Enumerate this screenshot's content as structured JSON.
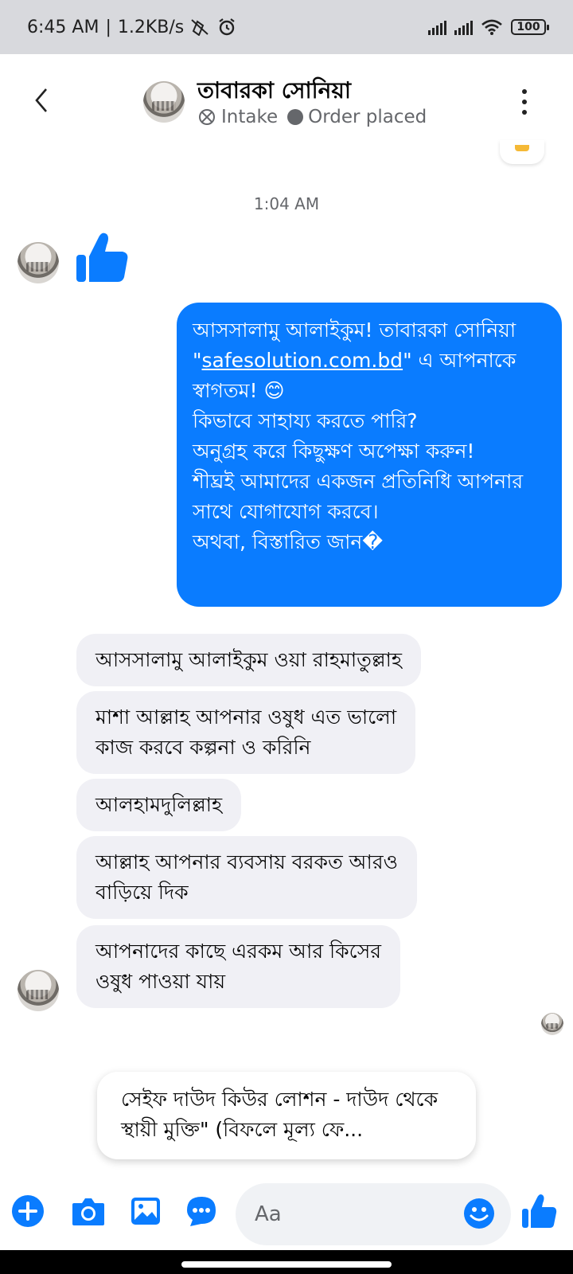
{
  "status_bar": {
    "time": "6:45 AM",
    "speed": "1.2KB/s",
    "battery": "100"
  },
  "header": {
    "contact_name": "তাবারকা সোনিয়া",
    "tag_intake": "Intake",
    "tag_order": "Order placed"
  },
  "chat": {
    "timestamp": "1:04 AM",
    "outgoing": {
      "line1": "আসসালামু আলাইকুম! তাবারকা সোনিয়া\n\"",
      "link": "safesolution.com.bd",
      "line2": "\" এ আপনাকে স্বাগতম! 😊\nকিভাবে সাহায্য করতে পারি?\nঅনুগ্রহ করে কিছুক্ষণ অপেক্ষা করুন!\nশীঘ্রই আমাদের একজন প্রতিনিধি আপনার সাথে যোগাযোগ করবে।\nঅথবা, বিস্তারিত জান�"
    },
    "incoming": [
      "আসসালামু আলাইকুম ওয়া রাহমাতুল্লাহ",
      "মাশা আল্লাহ আপনার ওষুধ এত ভালো\nকাজ করবে কল্পনা ও করিনি",
      "আলহামদুলিল্লাহ",
      "আল্লাহ আপনার ব্যবসায় বরকত আরও\nবাড়িয়ে দিক",
      "আপনাদের কাছে এরকম আর কিসের\nওষুধ পাওয়া যায়"
    ]
  },
  "suggestion": {
    "text": "সেইফ দাউদ কিউর লোশন - দাউদ থেকে স্থায়ী মুক্তি\" (বিফলে মূল্য ফে..."
  },
  "composer": {
    "placeholder": "Aa"
  },
  "colors": {
    "accent": "#0a7cff",
    "incoming_bubble": "#f0f0f5",
    "status_bar": "#d8d9dd"
  }
}
